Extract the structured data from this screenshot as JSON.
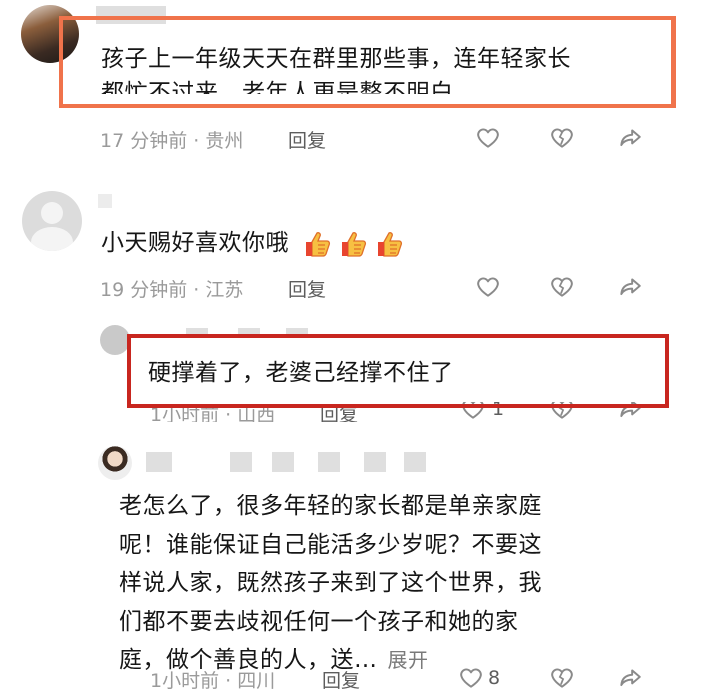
{
  "comments": [
    {
      "text_line1": "孩子上一年级天天在群里那些事，连年轻家长",
      "text_line2": "都忙不过来，老年人更是整不明白",
      "meta": "17 分钟前 · 贵州",
      "reply_label": "回复"
    },
    {
      "text": "小天赐好喜欢你哦",
      "emoji": [
        "thumbs-up",
        "thumbs-up",
        "thumbs-up"
      ],
      "meta": "19 分钟前 · 江苏",
      "reply_label": "回复"
    },
    {
      "text": "硬撑着了，老婆己经撑不住了",
      "meta": "1小时前 · 山西",
      "reply_label": "回复",
      "like_count": "1"
    },
    {
      "text_lines": [
        "老怎么了，很多年轻的家长都是单亲家庭",
        "呢！谁能保证自己能活多少岁呢？不要这",
        "样说人家，既然孩子来到了这个世界，我",
        "们都不要去歧视任何一个孩子和她的家",
        "庭，做个善良的人，送…"
      ],
      "expand_label": "展开",
      "meta": "1小时前 · 四川",
      "reply_label": "回复",
      "like_count": "8"
    }
  ],
  "colors": {
    "highlight_orange": "#f0734b",
    "highlight_red": "#c8261f",
    "icon_gray": "#8a8a8a"
  }
}
